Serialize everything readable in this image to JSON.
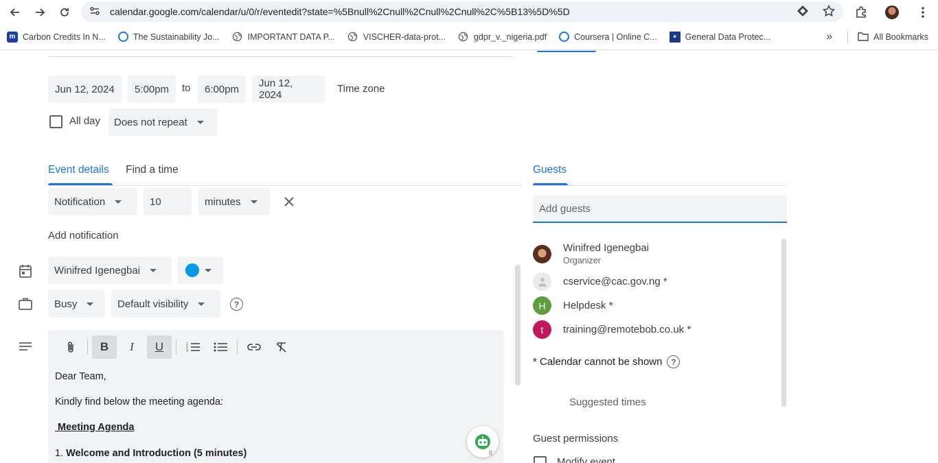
{
  "browser": {
    "url": "calendar.google.com/calendar/u/0/r/eventedit?state=%5Bnull%2Cnull%2Cnull%2Cnull%2C%5B13%5D%5D",
    "bookmarks": [
      {
        "label": "Carbon Credits In N...",
        "icon": "m-icon",
        "color": "#1a3f9e"
      },
      {
        "label": "The Sustainability Jo...",
        "icon": "c-icon",
        "color": "#1a73e8"
      },
      {
        "label": "IMPORTANT DATA P...",
        "icon": "globe-icon",
        "color": "#5f6368"
      },
      {
        "label": "VISCHER-data-prot...",
        "icon": "globe-icon",
        "color": "#5f6368"
      },
      {
        "label": "gdpr_v._nigeria.pdf",
        "icon": "globe-icon",
        "color": "#5f6368"
      },
      {
        "label": "Coursera | Online C...",
        "icon": "c-icon",
        "color": "#1a73e8"
      },
      {
        "label": "General Data Protec...",
        "icon": "gdpr-icon",
        "color": "#1b3a8c"
      }
    ],
    "all_bookmarks": "All Bookmarks"
  },
  "event": {
    "start_date": "Jun 12, 2024",
    "start_time": "5:00pm",
    "to_label": "to",
    "end_time": "6:00pm",
    "end_date": "Jun 12, 2024",
    "timezone_label": "Time zone",
    "allday_label": "All day",
    "repeat": "Does not repeat"
  },
  "tabs": {
    "details": "Event details",
    "find_time": "Find a time",
    "guests": "Guests"
  },
  "notification": {
    "type": "Notification",
    "value": "10",
    "unit": "minutes",
    "add_label": "Add notification"
  },
  "calendar": {
    "owner": "Winifred Igenegbai",
    "color": "#039be5",
    "busy": "Busy",
    "visibility": "Default visibility"
  },
  "editor": {
    "lines": [
      "Dear Team,",
      "Kindly find below the meeting agenda:",
      " Meeting Agenda",
      "1. ",
      "Welcome and Introduction (5 minutes)"
    ]
  },
  "guests": {
    "placeholder": "Add guests",
    "list": [
      {
        "name": "Winifred Igenegbai",
        "sub": "Organizer",
        "initial": "",
        "color": "#6b3a2a"
      },
      {
        "name": "cservice@cac.gov.ng *",
        "initial": "",
        "color": "#dadce0"
      },
      {
        "name": "Helpdesk *",
        "initial": "H",
        "color": "#5e9e3e"
      },
      {
        "name": "training@remotebob.co.uk *",
        "initial": "t",
        "color": "#c2185b"
      }
    ],
    "cannot_show": "* Calendar cannot be shown",
    "suggested": "Suggested times",
    "permissions": "Guest permissions",
    "modify": "Modify event"
  }
}
